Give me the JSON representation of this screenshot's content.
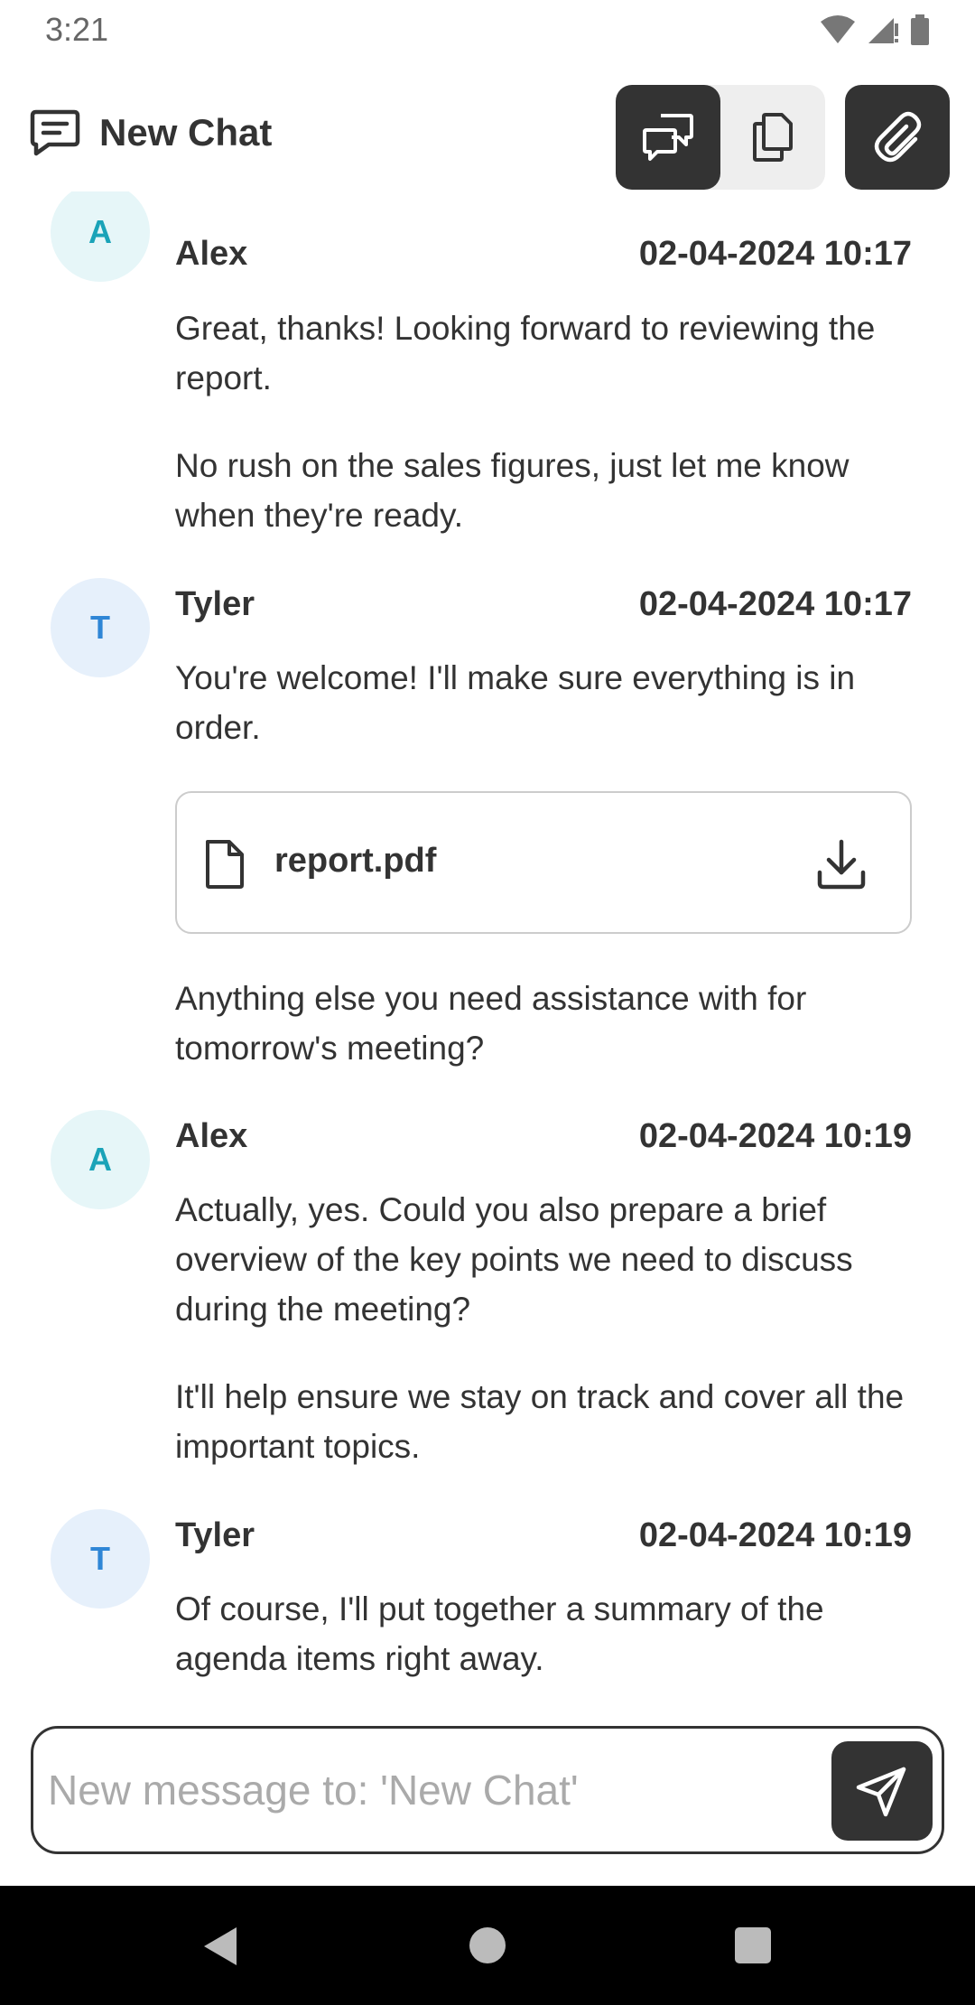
{
  "status_bar": {
    "time": "3:21"
  },
  "header": {
    "title": "New Chat",
    "title_icon": "chat-bubble-icon",
    "seg_active_icon": "conversations-icon",
    "seg_inactive_icon": "copy-icon",
    "attach_icon": "paperclip-icon"
  },
  "messages": [
    {
      "initial": "A",
      "sender": "Alex",
      "timestamp": "02-04-2024 10:17",
      "paragraphs": [
        "Great, thanks! Looking forward to reviewing the report.",
        "No rush on the sales figures, just let me know when they're ready."
      ]
    },
    {
      "initial": "T",
      "sender": "Tyler",
      "timestamp": "02-04-2024 10:17",
      "paragraphs": [
        "You're welcome! I'll make sure everything is in order.",
        "Anything else you need assistance with for tomorrow's meeting?"
      ],
      "attachment": {
        "file_name": "report.pdf"
      }
    },
    {
      "initial": "A",
      "sender": "Alex",
      "timestamp": "02-04-2024 10:19",
      "paragraphs": [
        "Actually, yes. Could you also prepare a brief overview of the key points we need to discuss during the meeting?",
        "It'll help ensure we stay on track and cover all the important topics."
      ]
    },
    {
      "initial": "T",
      "sender": "Tyler",
      "timestamp": "02-04-2024 10:19",
      "paragraphs": [
        "Of course, I'll put together a summary of the agenda items right away."
      ]
    }
  ],
  "composer": {
    "placeholder": "New message to: 'New Chat'",
    "value": ""
  },
  "colors": {
    "accent_dark": "#333333",
    "avatar_alex_bg": "#e6f6f8",
    "avatar_alex_text": "#1aa3b8",
    "avatar_tyler_bg": "#e6f0fb",
    "avatar_tyler_text": "#2f86d6"
  }
}
